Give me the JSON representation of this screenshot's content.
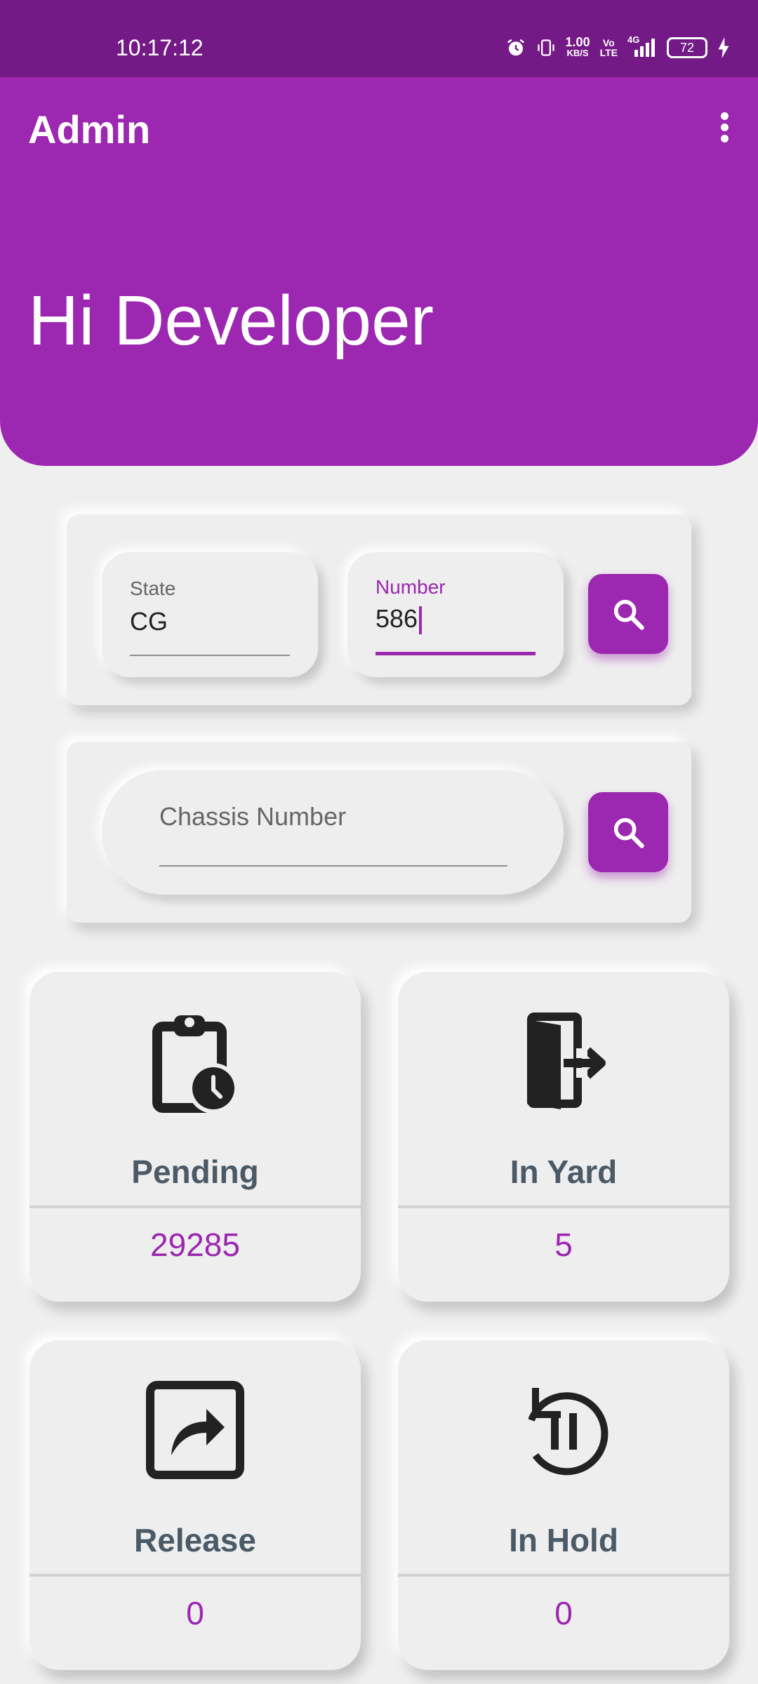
{
  "status_bar": {
    "time": "10:17:12",
    "speed": "1.00",
    "speed_unit": "KB/S",
    "volte_top": "Vo",
    "volte_bottom": "LTE",
    "network": "4G",
    "battery": "72"
  },
  "app_bar": {
    "title": "Admin"
  },
  "hero": {
    "greeting": "Hi Developer"
  },
  "vehicle_search": {
    "state_label": "State",
    "state_value": "CG",
    "number_label": "Number",
    "number_value": "586"
  },
  "chassis_search": {
    "placeholder": "Chassis Number"
  },
  "tiles": [
    {
      "label": "Pending",
      "count": "29285",
      "icon": "clipboard-clock-icon"
    },
    {
      "label": "In Yard",
      "count": "5",
      "icon": "door-exit-icon"
    },
    {
      "label": "Release",
      "count": "0",
      "icon": "share-box-icon"
    },
    {
      "label": "In Hold",
      "count": "0",
      "icon": "restart-pause-icon"
    }
  ],
  "colors": {
    "primary": "#9c27b0",
    "status_bar": "#741a86",
    "background": "#efefef",
    "tile_label": "#4a5a66"
  }
}
